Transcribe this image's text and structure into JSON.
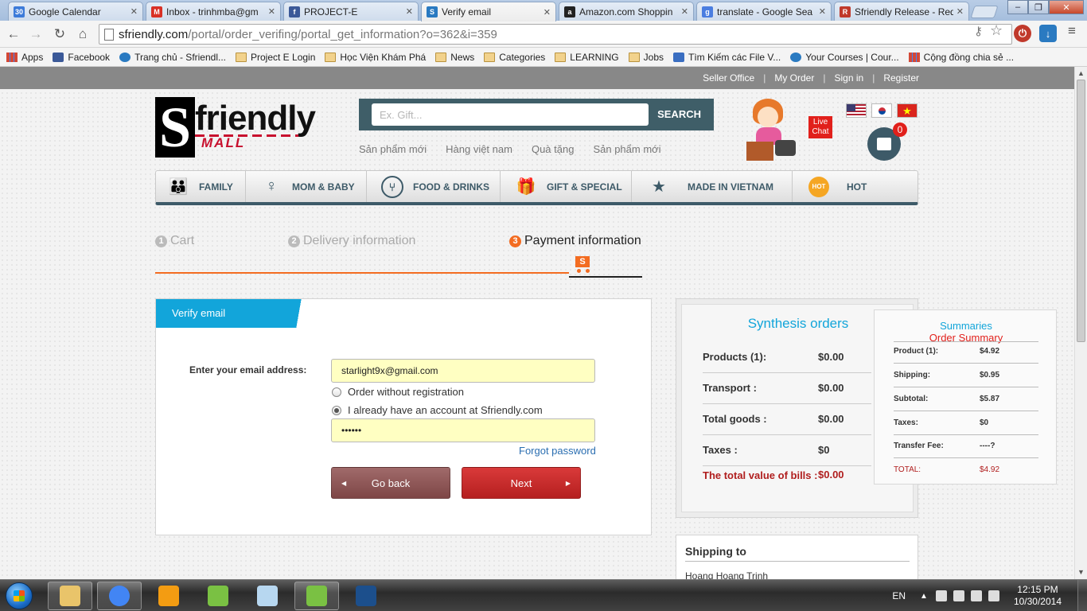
{
  "browser": {
    "tabs": [
      {
        "label": "Google Calendar",
        "favicon": "calendar-icon",
        "color": "#3d7bd9",
        "glyph": "30"
      },
      {
        "label": "Inbox - trinhmba@gm",
        "favicon": "gmail-icon",
        "color": "#d93025",
        "glyph": "M"
      },
      {
        "label": "PROJECT-E",
        "favicon": "facebook-icon",
        "color": "#3b5998",
        "glyph": "f"
      },
      {
        "label": "Verify email",
        "favicon": "sfriendly-icon",
        "color": "#2a7ac1",
        "glyph": "S"
      },
      {
        "label": "Amazon.com Shoppin",
        "favicon": "amazon-icon",
        "color": "#222222",
        "glyph": "a"
      },
      {
        "label": "translate - Google Sea",
        "favicon": "google-icon",
        "color": "#4a7de0",
        "glyph": "g"
      },
      {
        "label": "Sfriendly Release - Red",
        "favicon": "redmine-icon",
        "color": "#c0392b",
        "glyph": "R"
      }
    ],
    "active_tab": 3,
    "url_host": "sfriendly.com",
    "url_path": "/portal/order_verifing/portal_get_information?o=362&i=359",
    "bookmarks": [
      {
        "label": "Apps",
        "icon": "apps-icon",
        "type": "apps"
      },
      {
        "label": "Facebook",
        "icon": "facebook-icon",
        "type": "fb"
      },
      {
        "label": "Trang chủ - Sfriendl...",
        "icon": "sfriendly-icon",
        "type": "sf"
      },
      {
        "label": "Project E Login",
        "icon": "folder-icon",
        "type": "folder"
      },
      {
        "label": "Học Viện Khám Phá",
        "icon": "folder-icon",
        "type": "folder"
      },
      {
        "label": "News",
        "icon": "folder-icon",
        "type": "folder"
      },
      {
        "label": "Categories",
        "icon": "folder-icon",
        "type": "folder"
      },
      {
        "label": "LEARNING",
        "icon": "folder-icon",
        "type": "folder"
      },
      {
        "label": "Jobs",
        "icon": "folder-icon",
        "type": "folder"
      },
      {
        "label": "Tìm Kiếm các File V...",
        "icon": "search-icon",
        "type": "srch"
      },
      {
        "label": "Your Courses | Cour...",
        "icon": "coursera-icon",
        "type": "sf"
      },
      {
        "label": "Cộng đồng chia sẻ ...",
        "icon": "chart-icon",
        "type": "apps"
      }
    ]
  },
  "site": {
    "top_links": [
      "Seller Office",
      "My Order",
      "Sign in",
      "Register"
    ],
    "logo": {
      "s": "S",
      "word": "friendly",
      "mall": "MALL"
    },
    "search": {
      "placeholder": "Ex. Gift...",
      "button": "SEARCH"
    },
    "quick_links": [
      "Sản phẩm mới",
      "Hàng việt nam",
      "Quà tặng",
      "Sản phẩm mới"
    ],
    "live_chat": "Live Chat",
    "cart_count": "0",
    "categories": [
      {
        "label": "FAMILY",
        "icon": "family-icon",
        "glyph": "👪"
      },
      {
        "label": "MOM & BABY",
        "icon": "mom-baby-icon",
        "glyph": "♀"
      },
      {
        "label": "FOOD & DRINKS",
        "icon": "food-drinks-icon",
        "glyph": "⑂"
      },
      {
        "label": "GIFT & SPECIAL",
        "icon": "gift-icon",
        "glyph": "🎁"
      },
      {
        "label": "MADE IN VIETNAM",
        "icon": "star-icon",
        "glyph": "★"
      },
      {
        "label": "HOT",
        "icon": "hot-icon",
        "glyph": "HOT"
      }
    ]
  },
  "checkout": {
    "steps": [
      {
        "num": "1",
        "label": "Cart"
      },
      {
        "num": "2",
        "label": "Delivery information"
      },
      {
        "num": "3",
        "label": "Payment information"
      }
    ],
    "active_step": 2,
    "cart_glyph": "S",
    "verify": {
      "title": "Verify email",
      "email_label": "Enter your email address:",
      "email_value": "starlight9x@gmail.com",
      "option_guest": "Order without registration",
      "option_account": "I already have an account at Sfriendly.com",
      "selected_option": "account",
      "password_value": "••••••",
      "forgot": "Forgot password",
      "back_button": "Go back",
      "next_button": "Next"
    },
    "synthesis": {
      "title": "Synthesis orders",
      "rows": [
        {
          "label": "Products (1):",
          "value": "$0.00"
        },
        {
          "label": "Transport :",
          "value": "$0.00"
        },
        {
          "label": "Total goods :",
          "value": "$0.00"
        },
        {
          "label": "Taxes :",
          "value": "$0"
        },
        {
          "label": "The total value of bills :",
          "value": "$0.00"
        }
      ]
    },
    "summary": {
      "title": "Summaries",
      "subtitle": "Order Summary",
      "rows": [
        {
          "label": "Product (1):",
          "value": "$4.92"
        },
        {
          "label": "Shipping:",
          "value": "$0.95"
        },
        {
          "label": "Subtotal:",
          "value": "$5.87"
        },
        {
          "label": "Taxes:",
          "value": "$0"
        },
        {
          "label": "Transfer Fee:",
          "value": "----?"
        },
        {
          "label": "TOTAL:",
          "value": "$4.92"
        }
      ]
    },
    "shipping": {
      "title": "Shipping to",
      "name": "Hoang Hoang Trinh"
    }
  },
  "taskbar": {
    "language": "EN",
    "time": "12:15 PM",
    "date": "10/30/2014",
    "apps": [
      {
        "name": "explorer-icon",
        "color": "#e9c46a"
      },
      {
        "name": "chrome-icon",
        "color": "#4285f4"
      },
      {
        "name": "app-orange-icon",
        "color": "#f39c12"
      },
      {
        "name": "evernote-icon",
        "color": "#7ac143"
      },
      {
        "name": "notes-icon",
        "color": "#b7d7f0"
      },
      {
        "name": "evernote-icon",
        "color": "#7ac143"
      },
      {
        "name": "photoshop-icon",
        "color": "#1c4f8c"
      }
    ]
  }
}
